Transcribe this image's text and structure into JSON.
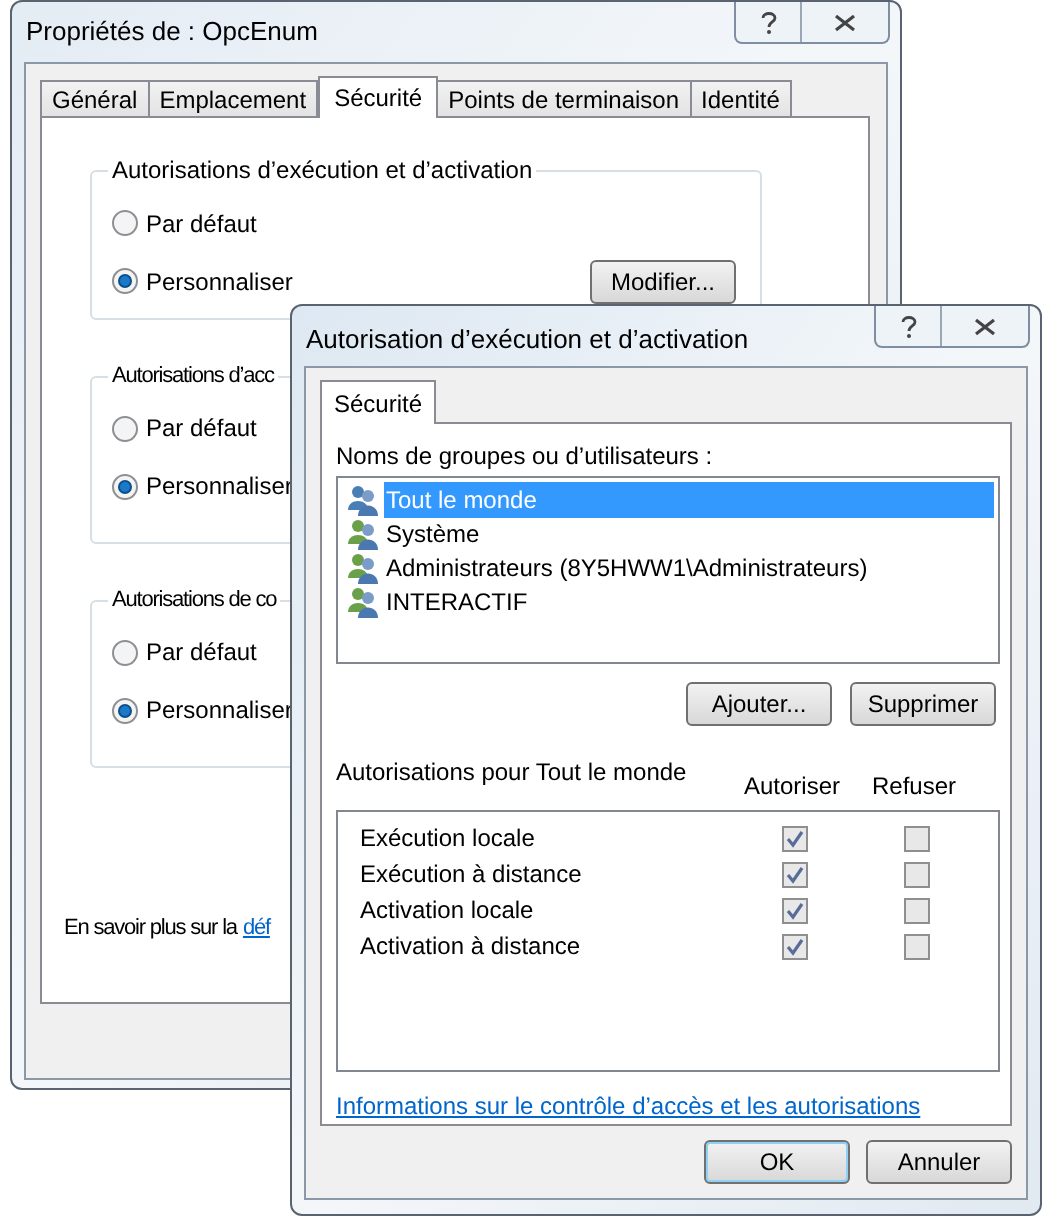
{
  "back_window": {
    "title": "Propriétés de : OpcEnum",
    "tabs": [
      {
        "label": "Général",
        "selected": false
      },
      {
        "label": "Emplacement",
        "selected": false
      },
      {
        "label": "Sécurité",
        "selected": true
      },
      {
        "label": "Points de terminaison",
        "selected": false
      },
      {
        "label": "Identité",
        "selected": false
      }
    ],
    "groups": [
      {
        "title": "Autorisations d’exécution et d’activation",
        "options": [
          {
            "label": "Par défaut",
            "selected": false
          },
          {
            "label": "Personnaliser",
            "selected": true
          }
        ],
        "button": "Modifier..."
      },
      {
        "title": "Autorisations d’acc",
        "options": [
          {
            "label": "Par défaut",
            "selected": false
          },
          {
            "label": "Personnaliser",
            "selected": true
          }
        ]
      },
      {
        "title": "Autorisations de co",
        "options": [
          {
            "label": "Par défaut",
            "selected": false
          },
          {
            "label": "Personnaliser",
            "selected": true
          }
        ]
      }
    ],
    "footer_text": "En savoir plus sur la",
    "footer_link": "déf"
  },
  "dialog": {
    "title": "Autorisation d’exécution et d’activation",
    "tabs": [
      {
        "label": "Sécurité",
        "selected": true
      }
    ],
    "users_label": "Noms de groupes ou d’utilisateurs :",
    "users": [
      {
        "name": "Tout le monde",
        "selected": true
      },
      {
        "name": "Système",
        "selected": false
      },
      {
        "name": "Administrateurs (8Y5HWW1\\Administrateurs)",
        "selected": false
      },
      {
        "name": "INTERACTIF",
        "selected": false
      }
    ],
    "buttons": [
      "Ajouter...",
      "Supprimer"
    ],
    "permissions_label": "Autorisations pour Tout le monde",
    "columns": [
      "Autoriser",
      "Refuser"
    ],
    "permissions": [
      {
        "name": "Exécution locale",
        "allow": true,
        "deny": false
      },
      {
        "name": "Exécution à distance",
        "allow": true,
        "deny": false
      },
      {
        "name": "Activation locale",
        "allow": true,
        "deny": false
      },
      {
        "name": "Activation à distance",
        "allow": true,
        "deny": false
      }
    ],
    "info_link": "Informations sur le contrôle d’accès et les autorisations",
    "footer_buttons": [
      {
        "label": "OK",
        "default": true
      },
      {
        "label": "Annuler",
        "default": false
      }
    ]
  }
}
